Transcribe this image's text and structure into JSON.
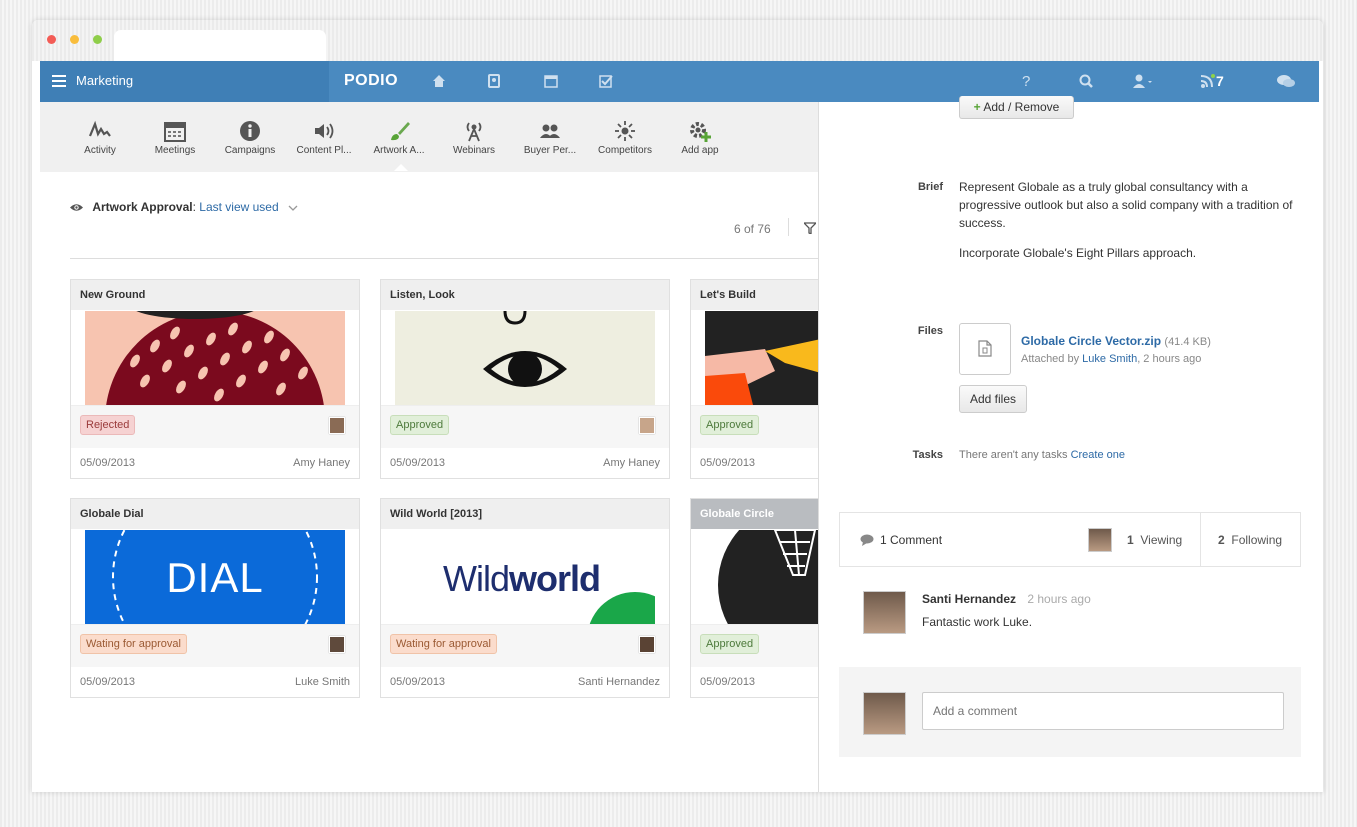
{
  "topbar": {
    "workspace": "Marketing",
    "logo": "PODIO",
    "notif_count": "7",
    "help": "?"
  },
  "apps": [
    {
      "label": "Activity",
      "icon": "activity-icon"
    },
    {
      "label": "Meetings",
      "icon": "calendar-icon"
    },
    {
      "label": "Campaigns",
      "icon": "info-icon"
    },
    {
      "label": "Content Pl...",
      "icon": "megaphone-icon"
    },
    {
      "label": "Artwork A...",
      "icon": "brush-icon"
    },
    {
      "label": "Webinars",
      "icon": "antenna-icon"
    },
    {
      "label": "Buyer Per...",
      "icon": "people-icon"
    },
    {
      "label": "Competitors",
      "icon": "burst-icon"
    },
    {
      "label": "Add app",
      "icon": "add-app-icon"
    }
  ],
  "view": {
    "app_name": "Artwork Approval",
    "view_name": "Last view used",
    "count": "6 of 76"
  },
  "cards": [
    {
      "title": "New Ground",
      "status": "Rejected",
      "date": "05/09/2013",
      "by": "Amy Haney"
    },
    {
      "title": "Listen, Look",
      "status": "Approved",
      "date": "05/09/2013",
      "by": "Amy Haney"
    },
    {
      "title": "Let's Build",
      "status": "Approved",
      "date": "05/09/2013",
      "by": ""
    },
    {
      "title": "Globale Dial",
      "status": "Wating for approval",
      "date": "05/09/2013",
      "by": "Luke Smith",
      "image_text": "DIAL"
    },
    {
      "title": "Wild World [2013]",
      "status": "Wating for approval",
      "date": "05/09/2013",
      "by": "Santi Hernandez",
      "image_text_a": "Wild",
      "image_text_b": "world"
    },
    {
      "title": "Globale Circle",
      "status": "Approved",
      "date": "05/09/2013",
      "by": ""
    }
  ],
  "detail": {
    "add_remove": "Add / Remove",
    "brief_label": "Brief",
    "brief_p1": "Represent Globale as a truly global consultancy with a progressive outlook but also a solid company with a tradition of success.",
    "brief_p2": "Incorporate Globale's Eight Pillars approach.",
    "files_label": "Files",
    "file_name": "Globale Circle Vector.zip",
    "file_size": "(41.4 KB)",
    "attached_prefix": "Attached by",
    "attached_by": "Luke Smith",
    "attached_when": ", 2 hours ago",
    "add_files": "Add files",
    "tasks_label": "Tasks",
    "tasks_text": "There aren't any tasks",
    "create_one": "Create one"
  },
  "comments_bar": {
    "comments": "1 Comment",
    "viewing_n": "1",
    "viewing": "Viewing",
    "following_n": "2",
    "following": "Following"
  },
  "comment": {
    "author": "Santi Hernandez",
    "time": "2 hours ago",
    "text": "Fantastic work Luke."
  },
  "add_comment": {
    "placeholder": "Add a comment"
  }
}
